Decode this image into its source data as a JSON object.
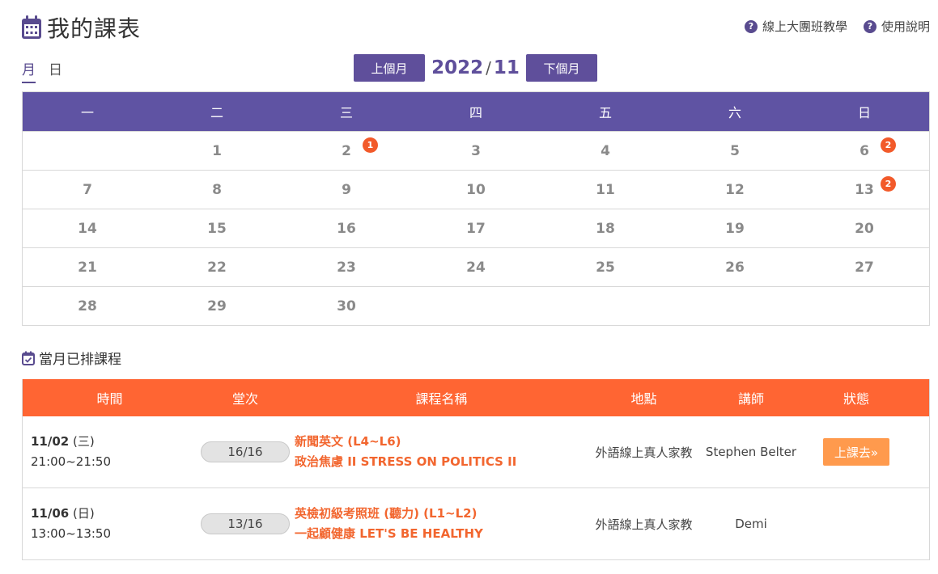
{
  "header": {
    "title": "我的課表",
    "links": [
      "線上大團班教學",
      "使用說明"
    ]
  },
  "view_tabs": [
    "月",
    "日"
  ],
  "month_nav": {
    "prev_label": "上個月",
    "next_label": "下個月",
    "year": "2022",
    "separator": "/",
    "month": "11"
  },
  "calendar": {
    "weekdays": [
      "一",
      "二",
      "三",
      "四",
      "五",
      "六",
      "日"
    ],
    "weeks": [
      [
        {
          "day": ""
        },
        {
          "day": "1"
        },
        {
          "day": "2",
          "badge": "1"
        },
        {
          "day": "3"
        },
        {
          "day": "4"
        },
        {
          "day": "5"
        },
        {
          "day": "6",
          "badge": "2"
        }
      ],
      [
        {
          "day": "7"
        },
        {
          "day": "8"
        },
        {
          "day": "9"
        },
        {
          "day": "10"
        },
        {
          "day": "11"
        },
        {
          "day": "12"
        },
        {
          "day": "13",
          "badge": "2"
        }
      ],
      [
        {
          "day": "14"
        },
        {
          "day": "15"
        },
        {
          "day": "16"
        },
        {
          "day": "17"
        },
        {
          "day": "18"
        },
        {
          "day": "19"
        },
        {
          "day": "20"
        }
      ],
      [
        {
          "day": "21"
        },
        {
          "day": "22"
        },
        {
          "day": "23"
        },
        {
          "day": "24"
        },
        {
          "day": "25"
        },
        {
          "day": "26"
        },
        {
          "day": "27"
        }
      ],
      [
        {
          "day": "28"
        },
        {
          "day": "29"
        },
        {
          "day": "30"
        },
        {
          "day": ""
        },
        {
          "day": ""
        },
        {
          "day": ""
        },
        {
          "day": ""
        }
      ]
    ]
  },
  "courses_section": {
    "title": "當月已排課程",
    "columns": [
      "時間",
      "堂次",
      "課程名稱",
      "地點",
      "講師",
      "狀態"
    ],
    "rows": [
      {
        "date": "11/02",
        "weekday": "(三)",
        "time": "21:00~21:50",
        "session": "16/16",
        "course_line1": "新聞英文 (L4~L6)",
        "course_line2": "政治焦慮 II STRESS ON POLITICS II",
        "location": "外語線上真人家教",
        "teacher": "Stephen Belter",
        "status_label": "上課去»"
      },
      {
        "date": "11/06",
        "weekday": "(日)",
        "time": "13:00~13:50",
        "session": "13/16",
        "course_line1": "英檢初級考照班 (聽力) (L1~L2)",
        "course_line2": "一起顧健康 LET'S BE HEALTHY",
        "location": "外語線上真人家教",
        "teacher": "Demi",
        "status_label": ""
      }
    ]
  },
  "colors": {
    "primary_purple": "#5f4f9b",
    "calendar_header": "#5f53a3",
    "table_header_orange": "#ff6533",
    "badge_red": "#f25a2a",
    "course_text_orange": "#f2662f",
    "go_button": "#ff9a4d"
  }
}
